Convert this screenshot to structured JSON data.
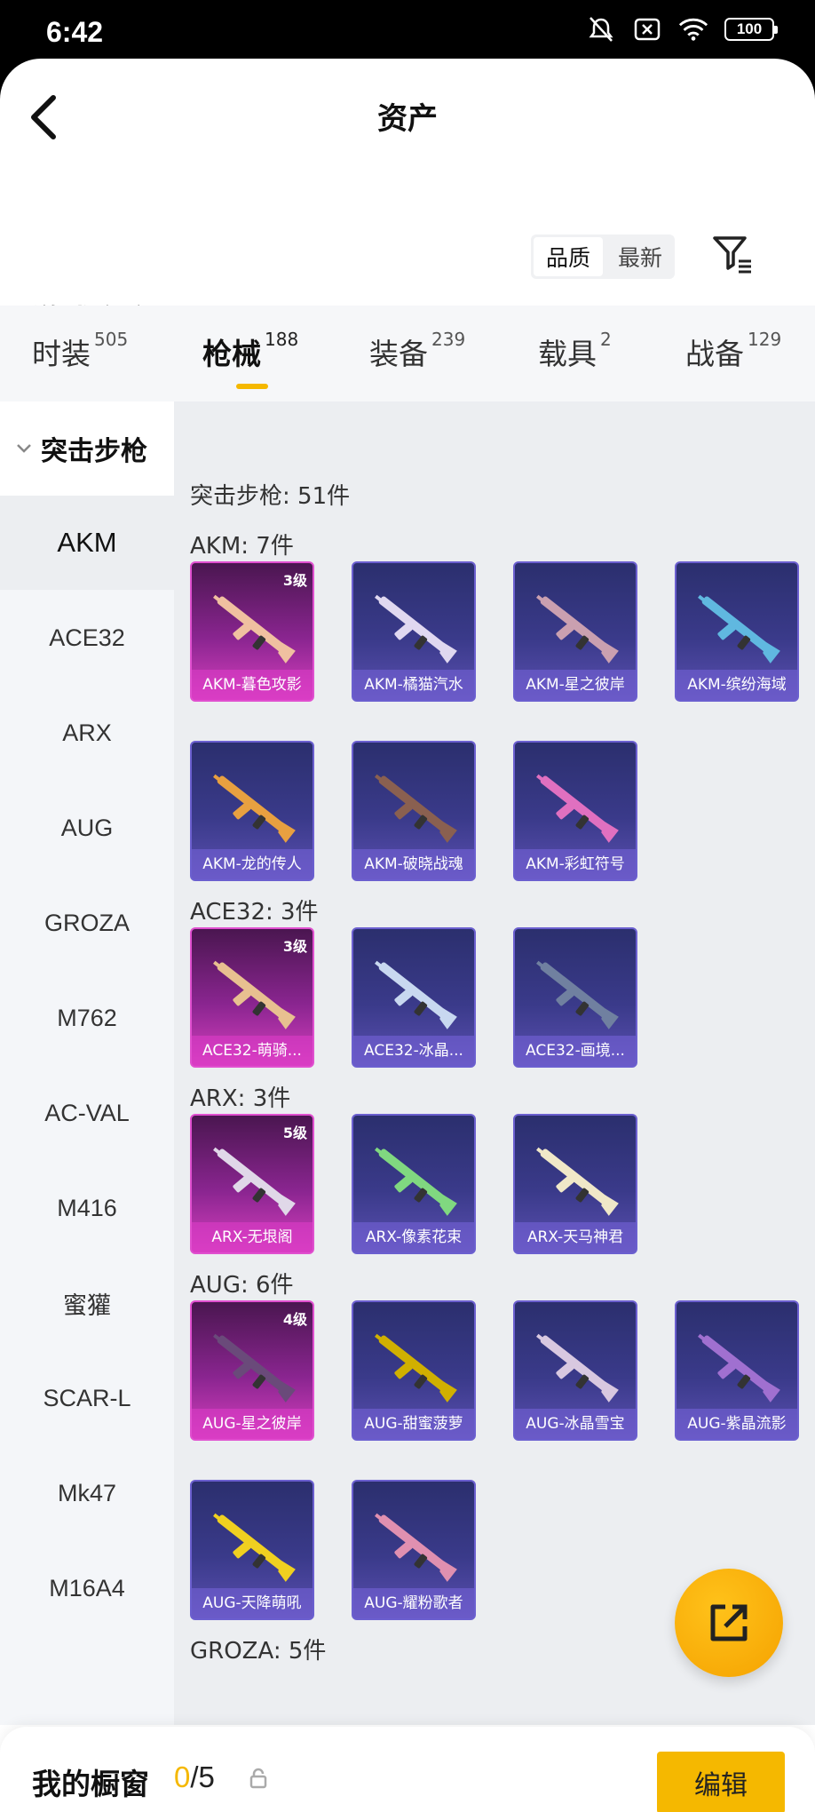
{
  "status": {
    "time": "6:42",
    "battery": "100"
  },
  "header": {
    "title": "资产"
  },
  "section": {
    "title": "游戏仓库",
    "sort": [
      "品质",
      "最新"
    ]
  },
  "tabs": [
    {
      "label": "时装",
      "count": "505"
    },
    {
      "label": "枪械",
      "count": "188"
    },
    {
      "label": "装备",
      "count": "239"
    },
    {
      "label": "载具",
      "count": "2"
    },
    {
      "label": "战备",
      "count": "129"
    }
  ],
  "sidebar": {
    "group": "突击步枪",
    "items": [
      "AKM",
      "ACE32",
      "ARX",
      "AUG",
      "GROZA",
      "M762",
      "AC-VAL",
      "M416",
      "蜜獾",
      "SCAR-L",
      "Mk47",
      "M16A4"
    ]
  },
  "content": {
    "summary": "突击步枪: 51件",
    "groups": [
      {
        "title": "AKM: 7件",
        "items": [
          {
            "name": "AKM-暮色攻影",
            "level": "3级",
            "rarity": "pink"
          },
          {
            "name": "AKM-橘猫汽水",
            "level": "",
            "rarity": "purple"
          },
          {
            "name": "AKM-星之彼岸",
            "level": "",
            "rarity": "purple"
          },
          {
            "name": "AKM-缤纷海域",
            "level": "",
            "rarity": "purple"
          },
          {
            "name": "AKM-龙的传人",
            "level": "",
            "rarity": "purple"
          },
          {
            "name": "AKM-破晓战魂",
            "level": "",
            "rarity": "purple"
          },
          {
            "name": "AKM-彩虹符号",
            "level": "",
            "rarity": "purple"
          }
        ]
      },
      {
        "title": "ACE32: 3件",
        "items": [
          {
            "name": "ACE32-萌骑...",
            "level": "3级",
            "rarity": "pink"
          },
          {
            "name": "ACE32-冰晶...",
            "level": "",
            "rarity": "purple"
          },
          {
            "name": "ACE32-画境...",
            "level": "",
            "rarity": "purple"
          }
        ]
      },
      {
        "title": "ARX: 3件",
        "items": [
          {
            "name": "ARX-无垠阁",
            "level": "5级",
            "rarity": "pink"
          },
          {
            "name": "ARX-像素花束",
            "level": "",
            "rarity": "purple"
          },
          {
            "name": "ARX-天马神君",
            "level": "",
            "rarity": "purple"
          }
        ]
      },
      {
        "title": "AUG: 6件",
        "items": [
          {
            "name": "AUG-星之彼岸",
            "level": "4级",
            "rarity": "pink"
          },
          {
            "name": "AUG-甜蜜菠萝",
            "level": "",
            "rarity": "purple"
          },
          {
            "name": "AUG-冰晶雪宝",
            "level": "",
            "rarity": "purple"
          },
          {
            "name": "AUG-紫晶流影",
            "level": "",
            "rarity": "purple"
          },
          {
            "name": "AUG-天降萌吼",
            "level": "",
            "rarity": "purple"
          },
          {
            "name": "AUG-耀粉歌者",
            "level": "",
            "rarity": "purple"
          }
        ]
      },
      {
        "title": "GROZA: 5件",
        "items": []
      }
    ]
  },
  "bottom": {
    "label": "我的橱窗",
    "current": "0",
    "max": "/5",
    "edit": "编辑"
  },
  "colors": {
    "accent": "#f5b800",
    "rarity_pink": "#d63fbe",
    "rarity_purple": "#5a4fb0"
  }
}
